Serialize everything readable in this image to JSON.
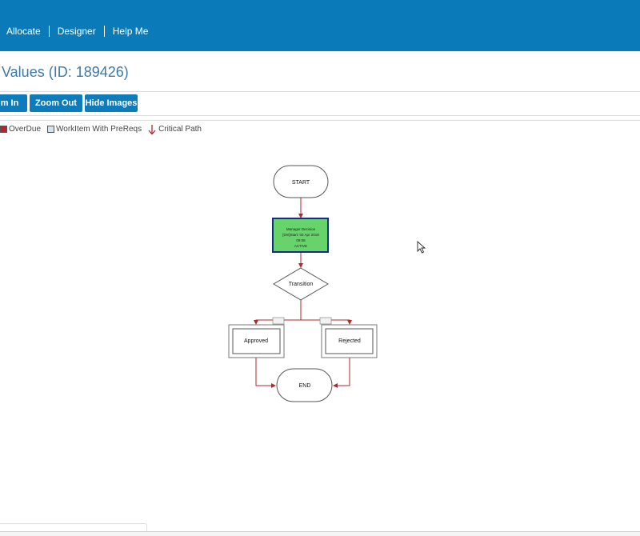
{
  "nav": {
    "items": [
      "Allocate",
      "Designer",
      "Help Me"
    ]
  },
  "page": {
    "title": "Values (ID: 189426)"
  },
  "toolbar": {
    "zoom_in_label": "m In",
    "zoom_out_label": "Zoom Out",
    "hide_images_label": "Hide Images"
  },
  "legend": {
    "overdue": "OverDue",
    "workitem_prereqs": "WorkItem With PreReqs",
    "critical_path": "Critical Path"
  },
  "workflow": {
    "start_label": "START",
    "task": {
      "line1": "Manager Decision",
      "line2": "[Dni]Start: 02 Apr 2018",
      "line3": "09:08",
      "line4": "ACTIVE"
    },
    "transition_label": "Transition",
    "approved_label": "Approved",
    "rejected_label": "Rejected",
    "end_label": "END"
  },
  "colors": {
    "header_bg": "#0a7ab8",
    "button_bg": "#0e7bbb",
    "title_text": "#3f79a6",
    "active_task_fill": "#66d46a",
    "active_task_border": "#1a2a8c",
    "critical_path": "#b3262e",
    "overdue": "#b3262e",
    "prereqs": "#d6e2ee"
  }
}
